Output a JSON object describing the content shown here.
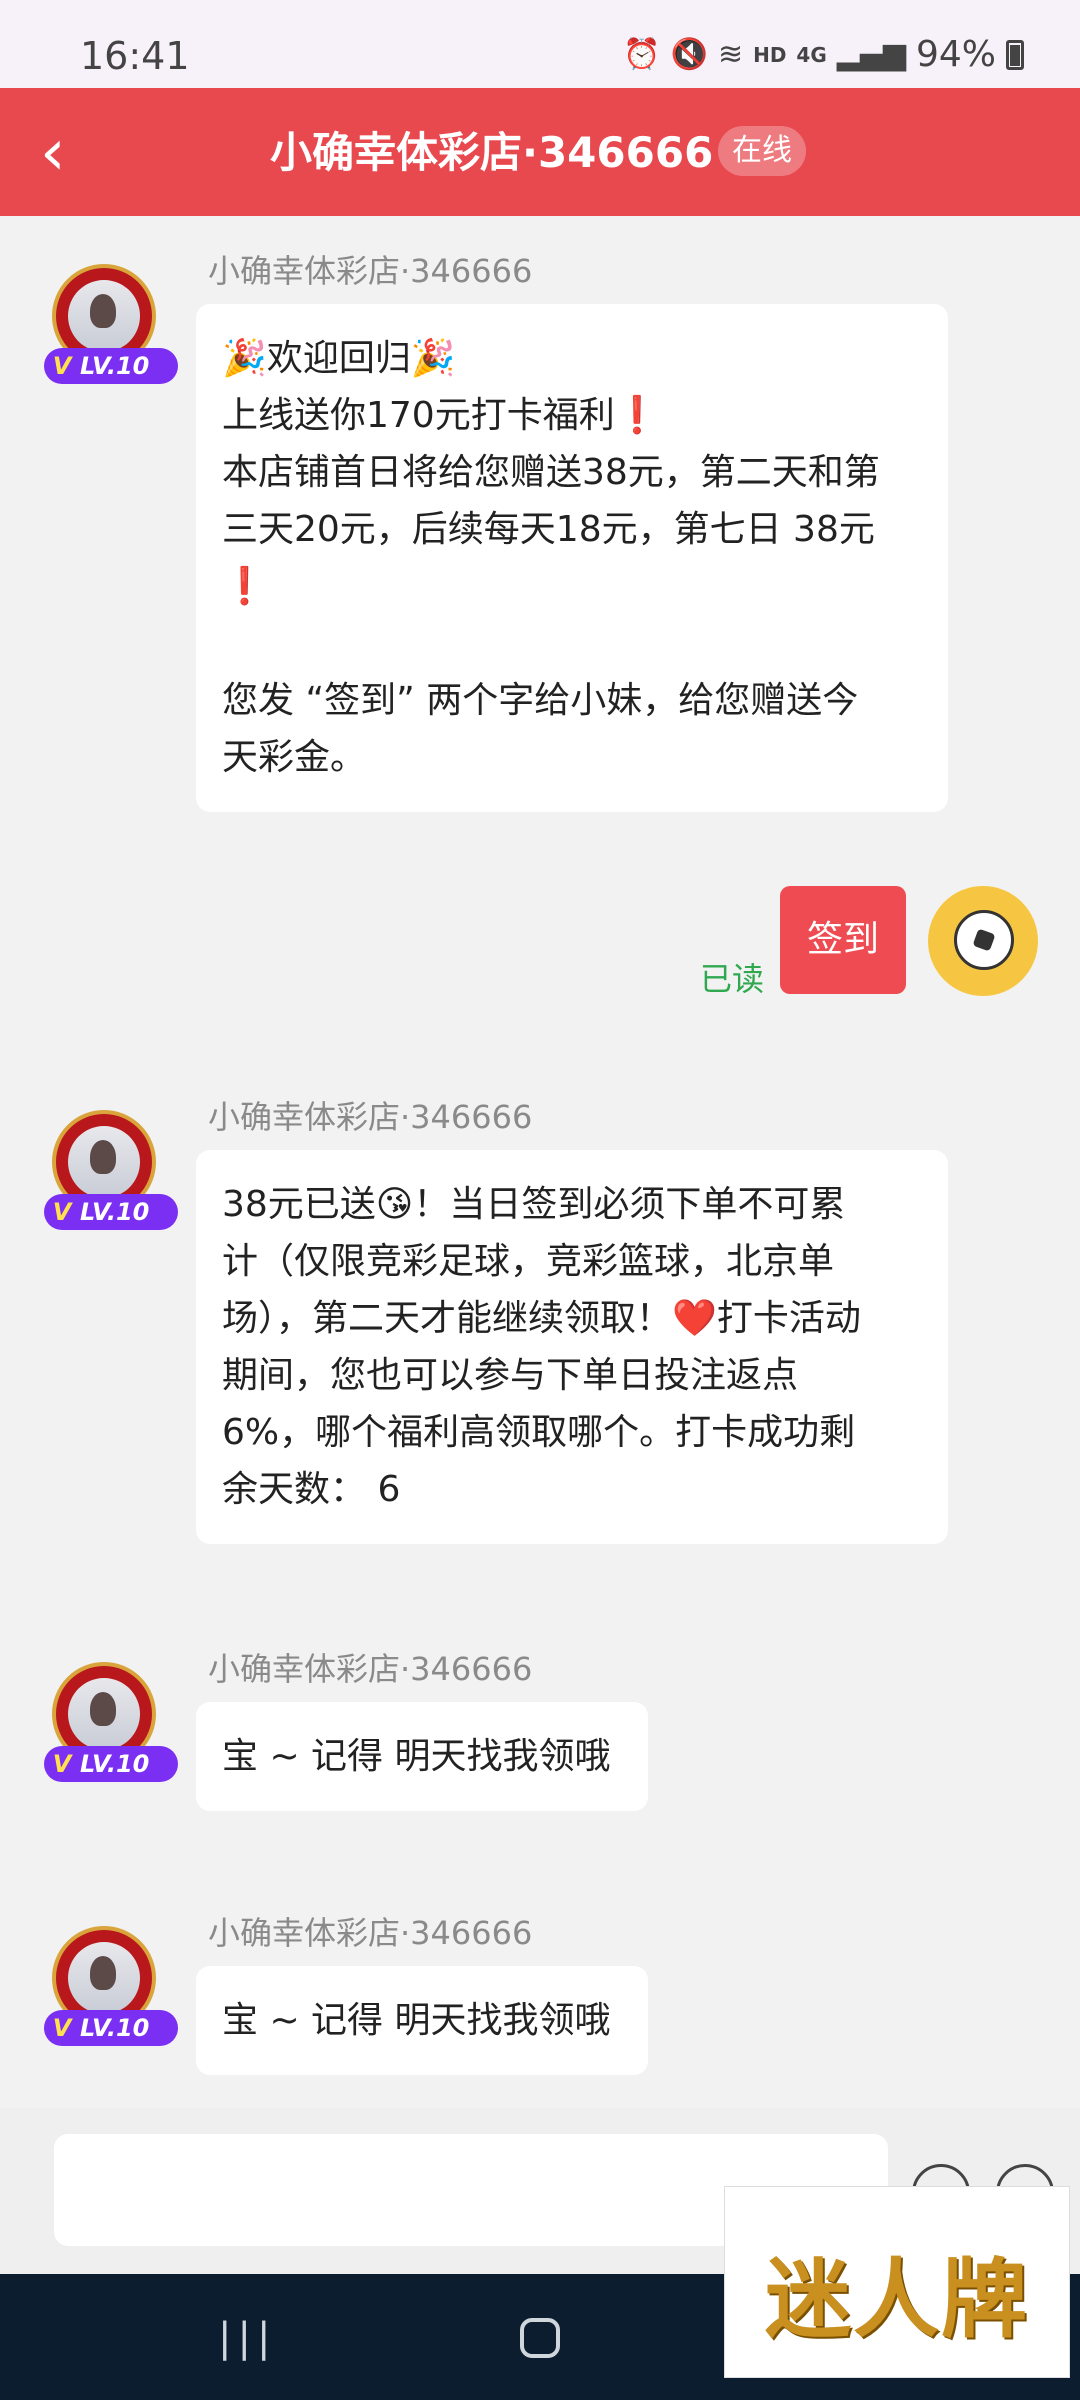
{
  "status_bar": {
    "time": "16:41",
    "network": "HD",
    "signal": "4G",
    "battery": "94%"
  },
  "header": {
    "back_icon": "chevron-left-icon",
    "title": "小确幸体彩店·346666",
    "status_badge": "在线"
  },
  "messages": [
    {
      "sender": "小确幸体彩店·346666",
      "level": "LV.10",
      "lines": [
        "🎉欢迎回归🎉",
        "上线送你170元打卡福利❗",
        "本店铺首日将给您赠送38元，第二天和第",
        "三天20元，后续每天18元，第七日 38元",
        "❗",
        "",
        "您发 “签到” 两个字给小妹，给您赠送今",
        "天彩金。"
      ]
    },
    {
      "sender": "小确幸体彩店·346666",
      "level": "LV.10",
      "lines": [
        "38元已送😘！当日签到必须下单不可累",
        "计（仅限竞彩足球，竞彩篮球，北京单",
        "场），第二天才能继续领取！❤️打卡活动",
        "期间，您也可以参与下单日投注返点",
        "6%，哪个福利高领取哪个。打卡成功剩",
        "余天数： 6"
      ]
    },
    {
      "sender": "小确幸体彩店·346666",
      "level": "LV.10",
      "lines": [
        "宝 ~ 记得 明天找我领哦"
      ]
    },
    {
      "sender": "小确幸体彩店·346666",
      "level": "LV.10",
      "lines": [
        "宝 ~ 记得 明天找我领哦"
      ]
    }
  ],
  "my_message": {
    "text": "签到",
    "read_status": "已读",
    "avatar_icon": "soccer-ball-icon"
  },
  "input": {
    "placeholder": ""
  },
  "watermark": {
    "text": "迷人牌"
  }
}
